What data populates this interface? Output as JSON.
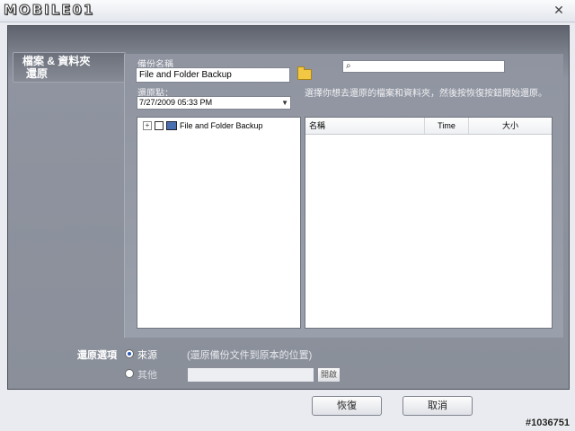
{
  "app": {
    "logo_text": "MOBILE01"
  },
  "tab": {
    "label_line1": "檔案 & 資料夾",
    "label_line2": "還原"
  },
  "backup_name": {
    "label": "備份名稱",
    "value": "File and Folder Backup"
  },
  "restore_point": {
    "label": "還原點：",
    "selected": "7/27/2009 05:33 PM"
  },
  "search": {
    "placeholder": ""
  },
  "hint": "選擇你想去還原的檔案和資料夾，然後按恢復按鈕開始還原。",
  "tree": {
    "items": [
      {
        "label": "File and Folder Backup"
      }
    ]
  },
  "list": {
    "columns": [
      "名稱",
      "Time",
      "大小"
    ]
  },
  "restore_options": {
    "label": "還原選項",
    "original": "來源",
    "other": "其他",
    "description": "(還原備份文件到原本的位置)",
    "browse_label": "開啟"
  },
  "footer": {
    "restore_label": "恢復",
    "cancel_label": "取消"
  },
  "watermark": "#1036751"
}
